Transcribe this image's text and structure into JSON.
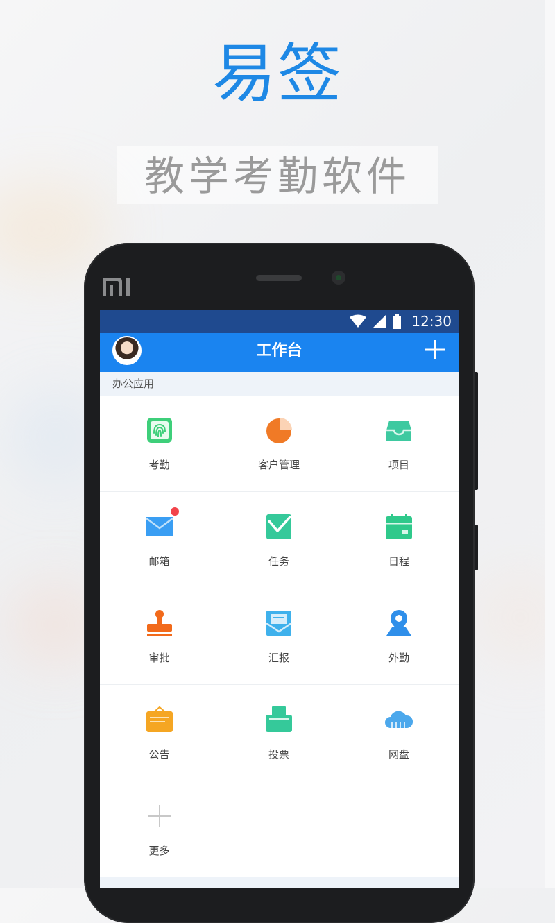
{
  "hero": {
    "title": "易签",
    "subtitle": "教学考勤软件"
  },
  "phone": {
    "brand_logo": "MI",
    "statusbar": {
      "icons": [
        "wifi-icon",
        "signal-icon",
        "battery-icon"
      ],
      "time": "12:30"
    },
    "appbar": {
      "title": "工作台",
      "add_icon": "plus-icon"
    },
    "section": {
      "title": "办公应用"
    },
    "apps": [
      {
        "label": "考勤",
        "icon": "fingerprint-icon",
        "color": "#3ecf7a"
      },
      {
        "label": "客户管理",
        "icon": "pie-chart-icon",
        "color": "#f07a26"
      },
      {
        "label": "项目",
        "icon": "inbox-tray-icon",
        "color": "#3ec9a0"
      },
      {
        "label": "邮箱",
        "icon": "mail-icon",
        "color": "#3a9ef3",
        "badge": true
      },
      {
        "label": "任务",
        "icon": "task-check-icon",
        "color": "#35c99a"
      },
      {
        "label": "日程",
        "icon": "calendar-icon",
        "color": "#2fc98b"
      },
      {
        "label": "审批",
        "icon": "stamp-icon",
        "color": "#f26a1b"
      },
      {
        "label": "汇报",
        "icon": "report-envelope-icon",
        "color": "#3fb1ec"
      },
      {
        "label": "外勤",
        "icon": "location-pin-icon",
        "color": "#2f8fea"
      },
      {
        "label": "公告",
        "icon": "notice-board-icon",
        "color": "#f5a623"
      },
      {
        "label": "投票",
        "icon": "ballot-box-icon",
        "color": "#35c99a"
      },
      {
        "label": "网盘",
        "icon": "cloud-icon",
        "color": "#4ca8ec"
      },
      {
        "label": "更多",
        "icon": "plus-more-icon",
        "color": "#c8c8c8"
      }
    ],
    "colors": {
      "statusbar": "#1f4a8f",
      "appbar": "#1a84f0",
      "accent": "#1e88e5"
    }
  }
}
